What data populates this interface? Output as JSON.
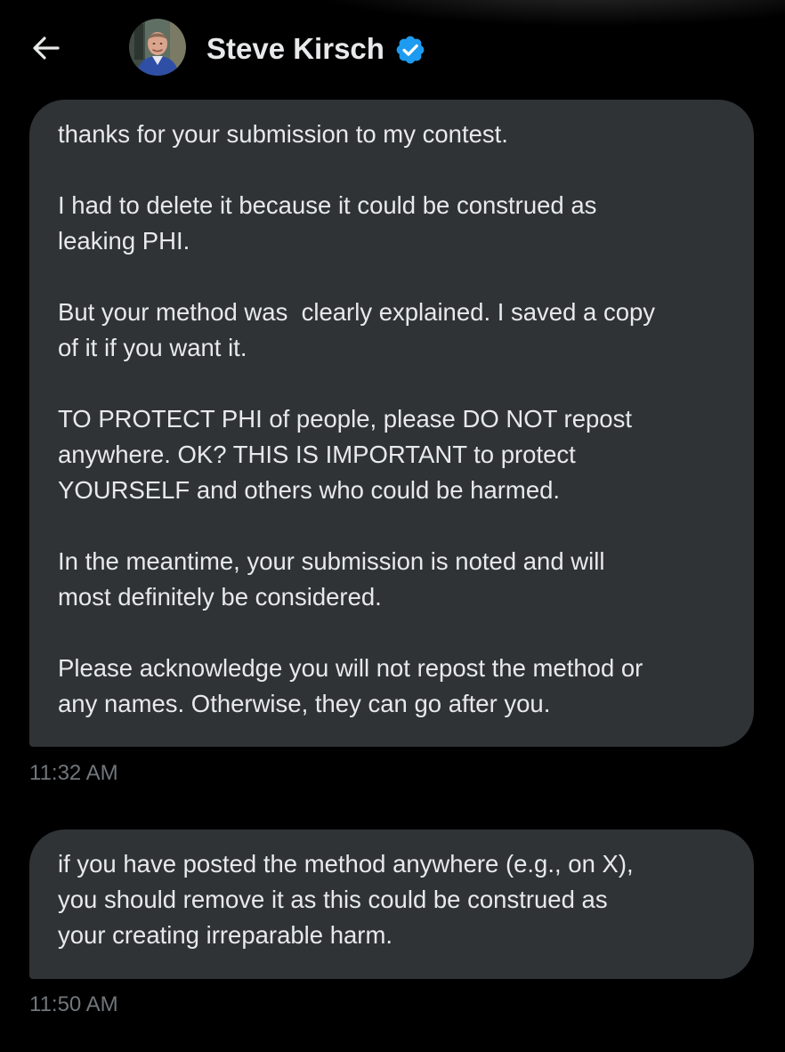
{
  "header": {
    "back_icon": "arrow-left-icon",
    "contact_name": "Steve Kirsch",
    "verified_icon": "verified-badge-icon",
    "accent_color": "#1d9bf0"
  },
  "messages": [
    {
      "paragraphs": [
        "thanks for your submission to my contest.",
        "I had to delete it because it could be construed as\nleaking PHI.",
        "But your method was  clearly explained. I saved a copy\nof it if you want it.",
        "TO PROTECT PHI of people, please DO NOT repost\nanywhere. OK? THIS IS IMPORTANT to protect\nYOURSELF and others who could be harmed.",
        "In the meantime, your submission is noted and will\nmost definitely be considered.",
        "Please acknowledge you will not repost the method or\nany names. Otherwise, they can go after you."
      ],
      "time": "11:32 AM"
    },
    {
      "paragraphs": [
        "if you have posted the method anywhere (e.g., on X),\nyou should remove it as this could be construed as\nyour creating irreparable harm."
      ],
      "time": "11:50 AM"
    }
  ],
  "colors": {
    "background": "#000000",
    "bubble": "#2f3336",
    "text": "#e7e9ea",
    "timestamp": "#71767b"
  }
}
